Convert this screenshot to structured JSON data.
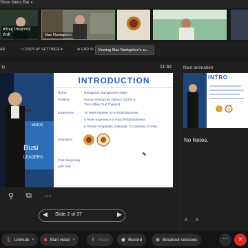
{
  "top": {
    "show_menu_bar": "Show Menu Bar"
  },
  "strip": {
    "tile1_label": "ศรัณยู ไชยสุรรณ์ภักดี",
    "tile2_label": "Max Nantaphon",
    "tooltip": "Viewing Max Nantaphon's sc..."
  },
  "toolbar": {
    "bar_label": "AR",
    "display_settings": "DISPLAY SETTINGS",
    "end_slideshow": "END SL"
  },
  "presenter": {
    "timer": "11:32",
    "slide_title": "INTRODUCTION",
    "rows": [
      {
        "label": "Name:",
        "value": "Nantaphon Jaengburiset (Max)"
      },
      {
        "label": "Position:",
        "value": "Human Resources Director Sizzler &"
      },
      {
        "label": "",
        "value": "The Coffee Club Thailand"
      },
      {
        "label": "Experience:",
        "value": "15 Years experience in Hotel Business"
      },
      {
        "label": "",
        "value": "6 Years experience in Food Retail Business"
      },
      {
        "label": "",
        "value": "8 Global Companies, 8 Brands, 3 Countries, 6 Cities"
      },
      {
        "label": "Education:",
        "value": ""
      },
      {
        "label": "From beginning",
        "value": ""
      },
      {
        "label": "until now:",
        "value": ""
      }
    ],
    "photo_text1": "MINOR",
    "photo_text2": "Busi",
    "photo_text3": "LEADERS",
    "slide_counter": "Slide 2 of 37"
  },
  "right": {
    "next_animation": "Next animation",
    "next_title": "INTRO",
    "notes": "No Notes.",
    "font_up": "A",
    "font_down": "A"
  },
  "bottom": {
    "unmute": "Unmute",
    "start_video": "Start video",
    "share": "Share",
    "record": "Record",
    "breakout": "Breakout sessions"
  },
  "colors": {
    "accent_blue": "#2860c4",
    "leave_red": "#e02828"
  }
}
